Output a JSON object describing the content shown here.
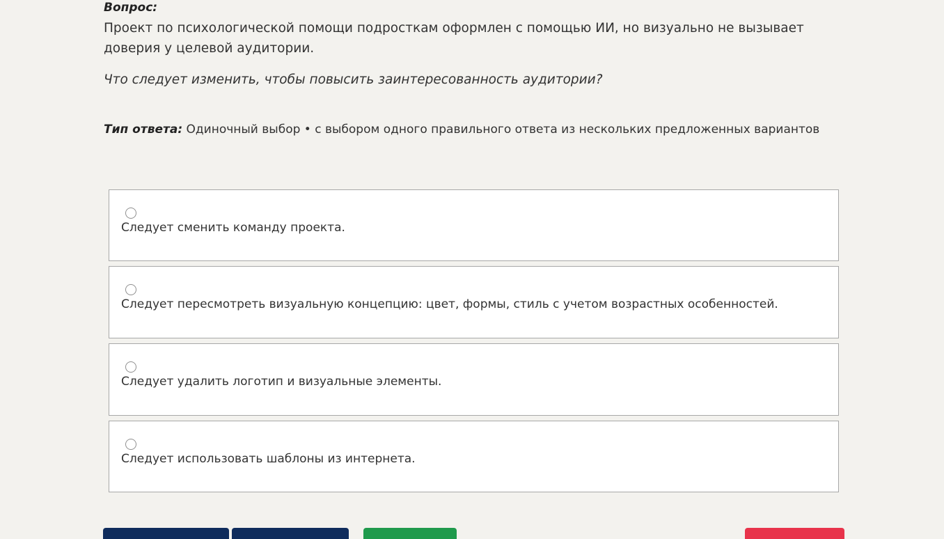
{
  "question": {
    "label": "Вопрос:",
    "text": "Проект по психологической помощи подросткам оформлен с помощью ИИ, но визуально не вызывает доверия у целевой аудитории.",
    "prompt": "Что следует изменить, чтобы повысить заинтересованность аудитории?"
  },
  "answer_type": {
    "label": "Тип ответа:",
    "value": "Одиночный выбор • с выбором одного правильного ответа из нескольких предложенных вариантов"
  },
  "options": [
    {
      "text": "Следует сменить команду проекта.",
      "selected": false
    },
    {
      "text": "Следует пересмотреть визуальную концепцию: цвет, формы, стиль с учетом возрастных особенностей.",
      "selected": false
    },
    {
      "text": "Следует удалить логотип и визуальные элементы.",
      "selected": false
    },
    {
      "text": "Следует использовать шаблоны из интернета.",
      "selected": false
    }
  ],
  "buttons": {
    "prev_label": "",
    "next_label": "",
    "answer_label": "",
    "finish_label": ""
  },
  "colors": {
    "background": "#f3f2ee",
    "nav_button": "#0f2c5c",
    "answer_button": "#1f9a4c",
    "finish_button": "#e8344b"
  }
}
